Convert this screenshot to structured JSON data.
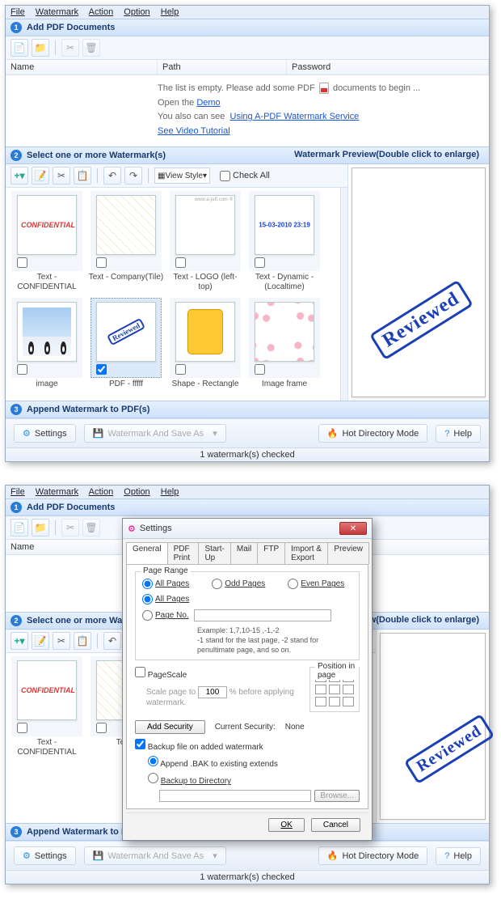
{
  "menubar": {
    "file": "File",
    "watermark": "Watermark",
    "action": "Action",
    "option": "Option",
    "help": "Help"
  },
  "sections": {
    "s1": "Add PDF Documents",
    "s2": "Select one or more Watermark(s)",
    "s3": "Append Watermark to PDF(s)",
    "preview_header": "Watermark Preview(Double click to enlarge)"
  },
  "listcols": {
    "name": "Name",
    "path": "Path",
    "password": "Password"
  },
  "empty": {
    "line1a": "The list is empty. Please add some PDF",
    "line1b": "documents to begin ...",
    "open_the": "Open the",
    "demo_link": "Demo",
    "also_see": "You also can see",
    "service_link": "Using A-PDF Watermark Service",
    "video_link": "See Video Tutorial"
  },
  "wm_toolbar": {
    "viewstyle": "View Style",
    "checkall": "Check All"
  },
  "thumbs": {
    "t0": {
      "caption": "Text - CONFIDENTIAL"
    },
    "t1": {
      "caption": "Text - Company(Tile)"
    },
    "t2": {
      "caption": "Text - LOGO (left-top)"
    },
    "t3": {
      "caption": "Text - Dynamic - (Localtime)",
      "datetime": "15-03-2010 23:19"
    },
    "t4": {
      "caption": "image"
    },
    "t5": {
      "caption": "PDF - fffff",
      "stamp": "Reviewed"
    },
    "t6": {
      "caption": "Shape - Rectangle"
    },
    "t7": {
      "caption": "Image frame"
    }
  },
  "preview": {
    "stamp": "Reviewed"
  },
  "bottom": {
    "settings": "Settings",
    "wmsave": "Watermark And Save As",
    "hotdir": "Hot Directory Mode",
    "help": "Help"
  },
  "status": {
    "checked": "1 watermark(s) checked"
  },
  "settings": {
    "title": "Settings",
    "tabs": {
      "general": "General",
      "pdfprint": "PDF Print",
      "startup": "Start-Up",
      "mail": "Mail",
      "ftp": "FTP",
      "import": "Import & Export",
      "preview": "Preview"
    },
    "page_range": "Page Range",
    "all_pages": "All Pages",
    "odd_pages": "Odd Pages",
    "even_pages": "Even Pages",
    "page_no": "Page No.",
    "example": "Example: 1,7,10-15 ,-1,-2",
    "example2": "-1 stand for the last page, -2 stand for penultimate page, and so on.",
    "pagescale": "PageScale",
    "scale_to": "Scale page to",
    "scale_val": "100",
    "before_apply": "% before applying watermark.",
    "pos_in_page": "Position in page",
    "add_security": "Add Security",
    "cur_security": "Current Security:",
    "none": "None",
    "backup_cb": "Backup file on added watermark",
    "append_bak": "Append .BAK to existing extends",
    "backup_dir": "Backup to Directory",
    "browse": "Browse...",
    "ok": "OK",
    "cancel": "Cancel"
  }
}
